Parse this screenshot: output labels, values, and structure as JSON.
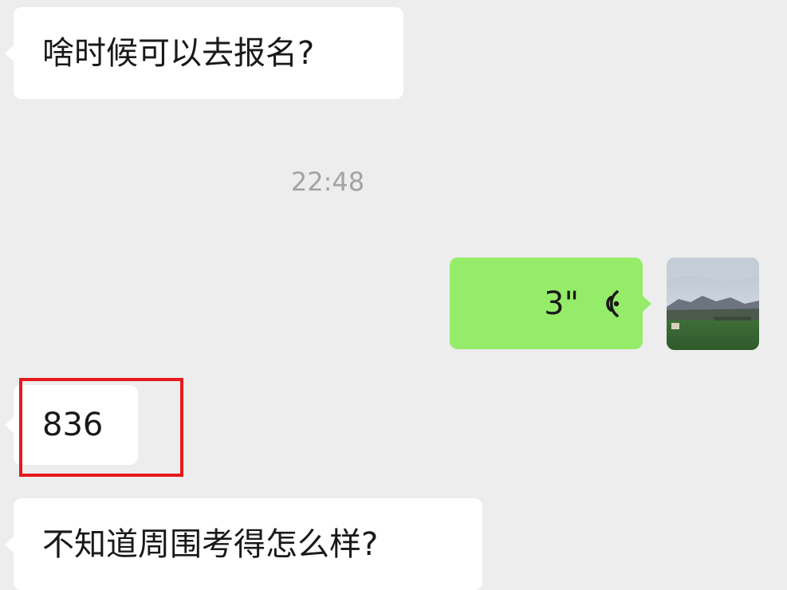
{
  "messages": {
    "m1": "啥时候可以去报名?",
    "timestamp": "22:48",
    "voice_duration": "3\"",
    "m2": "836",
    "m3": "不知道周围考得怎么样?"
  },
  "colors": {
    "background": "#ededed",
    "incoming_bubble": "#ffffff",
    "outgoing_bubble": "#95ec69",
    "highlight": "#e5191e",
    "timestamp_text": "#a3a3a3"
  },
  "icons": {
    "voice": "voice-wave-icon",
    "avatar": "landscape-avatar"
  }
}
